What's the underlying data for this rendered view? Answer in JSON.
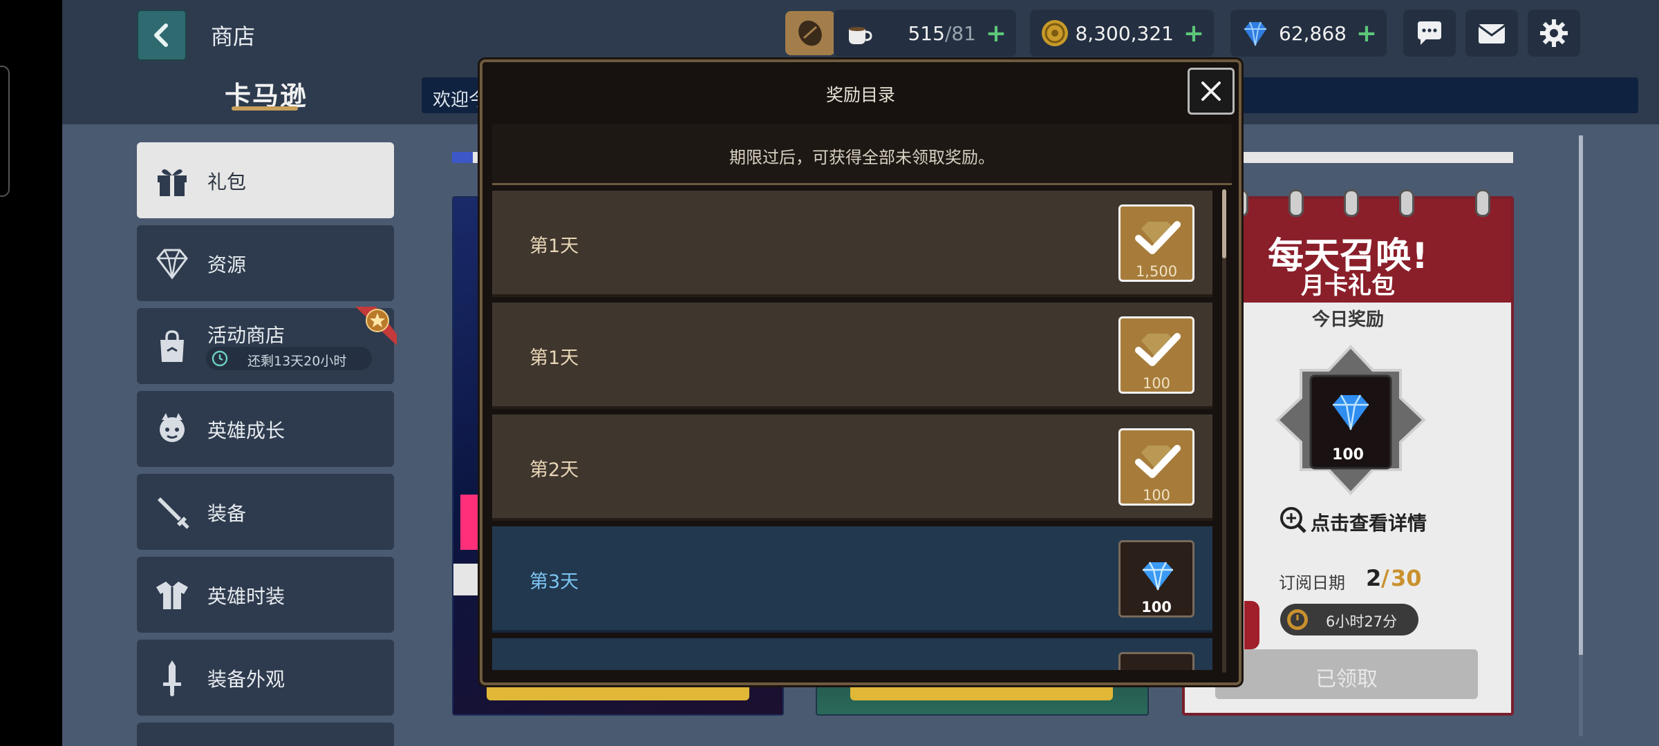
{
  "header": {
    "title": "商店",
    "brand": "卡马逊",
    "welcome": "欢迎今"
  },
  "resources": {
    "stamina": {
      "value": "515",
      "max": "/81",
      "icon": "coffee-cup-icon"
    },
    "gold": {
      "value": "8,300,321",
      "icon": "gold-coin-icon"
    },
    "gems": {
      "value": "62,868",
      "icon": "diamond-icon"
    },
    "plus": "+"
  },
  "sidebar": {
    "items": [
      {
        "label": "礼包",
        "icon": "gift-icon",
        "active": true
      },
      {
        "label": "资源",
        "icon": "diamond-outline-icon"
      },
      {
        "label": "活动商店",
        "icon": "shopping-bag-icon",
        "sub": "还剩13天20小时"
      },
      {
        "label": "英雄成长",
        "icon": "hero-face-icon"
      },
      {
        "label": "装备",
        "icon": "sword-icon"
      },
      {
        "label": "英雄时装",
        "icon": "costume-icon"
      },
      {
        "label": "装备外观",
        "icon": "sword-skin-icon"
      }
    ]
  },
  "monthly_card": {
    "title": "每天召唤!",
    "subtitle": "月卡礼包",
    "today_label": "今日奖励",
    "today_value": "100",
    "detail": "点击查看详情",
    "subs_label": "订阅日期",
    "subs_current": "2",
    "subs_sep": "/",
    "subs_total": "30",
    "timer": "6小时27分",
    "claim_button": "已领取"
  },
  "modal": {
    "title": "奖励目录",
    "notice": "期限过后，可获得全部未领取奖励。",
    "rows": [
      {
        "day": "第1天",
        "qty": "1,500",
        "state": "claimed"
      },
      {
        "day": "第1天",
        "qty": "100",
        "state": "claimed"
      },
      {
        "day": "第2天",
        "qty": "100",
        "state": "claimed"
      },
      {
        "day": "第3天",
        "qty": "100",
        "state": "current"
      }
    ]
  },
  "colors": {
    "accent_gold": "#a77c3a",
    "current_row": "#22384f",
    "plus_green": "#5cc77a",
    "brand_red": "#8a1f2a"
  }
}
